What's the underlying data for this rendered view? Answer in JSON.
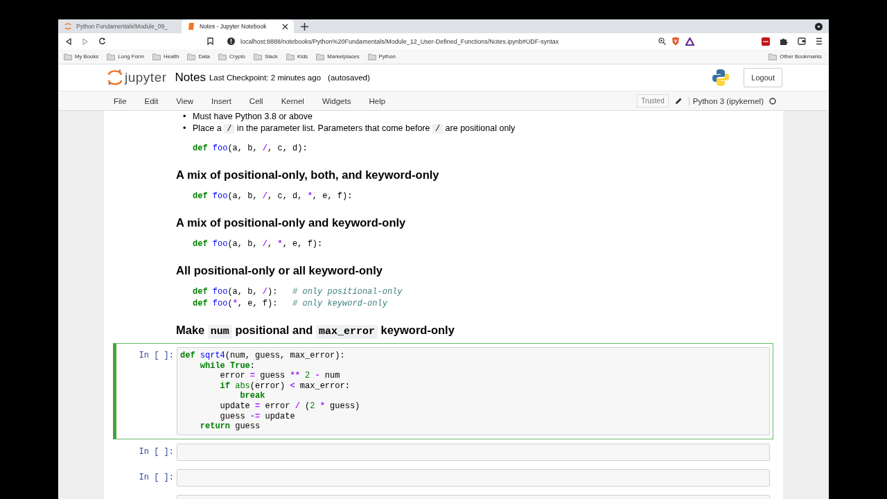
{
  "browser": {
    "tabs": [
      {
        "title": "Python Fundamentals/Module_09_",
        "selected": false
      },
      {
        "title": "Notes - Jupyter Notebook",
        "selected": true
      }
    ],
    "url": "localhost:8888/notebooks/Python%20Fundamentals/Module_12_User-Defined_Functions/Notes.ipynb#UDF-syntax",
    "bookmarks": [
      "My Books",
      "Long Form",
      "Health",
      "Data",
      "Crypto",
      "Slack",
      "Kids",
      "Marketplaces",
      "Python"
    ],
    "other_bookmarks": "Other Bookmarks"
  },
  "header": {
    "logo_text": "jupyter",
    "notebook_name": "Notes",
    "checkpoint": "Last Checkpoint: 2 minutes ago",
    "autosave": "(autosaved)",
    "logout": "Logout"
  },
  "menu": [
    "File",
    "Edit",
    "View",
    "Insert",
    "Cell",
    "Kernel",
    "Widgets",
    "Help"
  ],
  "toolbar": {
    "trusted": "Trusted",
    "kernel": "Python 3 (ipykernel)",
    "kernel_busy": false
  },
  "markdown": [
    {
      "kind": "bullets",
      "items": [
        {
          "marker": "•",
          "segments": [
            {
              "kind": "text",
              "text": "Must have Python 3.8 or above"
            }
          ]
        },
        {
          "marker": "•",
          "segments": [
            {
              "kind": "text",
              "text": "Place a "
            },
            {
              "kind": "code",
              "text": "/"
            },
            {
              "kind": "text",
              "text": " in the parameter list. Parameters that come before "
            },
            {
              "kind": "code",
              "text": "/"
            },
            {
              "kind": "text",
              "text": " are positional only"
            }
          ]
        }
      ]
    },
    {
      "kind": "code",
      "lines": [
        [
          {
            "kind": "kw",
            "text": "def"
          },
          {
            "kind": "fn",
            "text": " foo"
          },
          {
            "kind": "plain",
            "text": "(a, b, "
          },
          {
            "kind": "op",
            "text": "/"
          },
          {
            "kind": "plain",
            "text": ", c, d):"
          }
        ]
      ]
    },
    {
      "kind": "heading",
      "segments": [
        {
          "kind": "text",
          "text": "A mix of positional-only, both, and keyword-only"
        }
      ]
    },
    {
      "kind": "code",
      "lines": [
        [
          {
            "kind": "kw",
            "text": "def"
          },
          {
            "kind": "fn",
            "text": " foo"
          },
          {
            "kind": "plain",
            "text": "(a, b, "
          },
          {
            "kind": "op",
            "text": "/"
          },
          {
            "kind": "plain",
            "text": ", c, d, "
          },
          {
            "kind": "op",
            "text": "*"
          },
          {
            "kind": "plain",
            "text": ", e, f):"
          }
        ]
      ]
    },
    {
      "kind": "heading",
      "segments": [
        {
          "kind": "text",
          "text": "A mix of positional-only and keyword-only"
        }
      ]
    },
    {
      "kind": "code",
      "lines": [
        [
          {
            "kind": "kw",
            "text": "def"
          },
          {
            "kind": "fn",
            "text": " foo"
          },
          {
            "kind": "plain",
            "text": "(a, b, "
          },
          {
            "kind": "op",
            "text": "/"
          },
          {
            "kind": "plain",
            "text": ", "
          },
          {
            "kind": "op",
            "text": "*"
          },
          {
            "kind": "plain",
            "text": ", e, f):"
          }
        ]
      ]
    },
    {
      "kind": "heading",
      "segments": [
        {
          "kind": "text",
          "text": "All positional-only or all keyword-only"
        }
      ]
    },
    {
      "kind": "code",
      "lines": [
        [
          {
            "kind": "kw",
            "text": "def"
          },
          {
            "kind": "fn",
            "text": " foo"
          },
          {
            "kind": "plain",
            "text": "(a, b, "
          },
          {
            "kind": "op",
            "text": "/"
          },
          {
            "kind": "plain",
            "text": "):   "
          },
          {
            "kind": "comment",
            "text": "# only positional-only"
          }
        ],
        [
          {
            "kind": "kw",
            "text": "def"
          },
          {
            "kind": "fn",
            "text": " foo"
          },
          {
            "kind": "plain",
            "text": "("
          },
          {
            "kind": "op",
            "text": "*"
          },
          {
            "kind": "plain",
            "text": ", e, f):   "
          },
          {
            "kind": "comment",
            "text": "# only keyword-only"
          }
        ]
      ]
    },
    {
      "kind": "heading",
      "segments": [
        {
          "kind": "text",
          "text": "Make "
        },
        {
          "kind": "code",
          "text": "num"
        },
        {
          "kind": "text",
          "text": " positional and "
        },
        {
          "kind": "code",
          "text": "max_error"
        },
        {
          "kind": "text",
          "text": " keyword-only"
        }
      ]
    }
  ],
  "cells": [
    {
      "prompt": "In [ ]:",
      "selected": true,
      "lines": [
        [
          {
            "kind": "kw",
            "text": "def"
          },
          {
            "kind": "fn",
            "text": " sqrt4"
          },
          {
            "kind": "plain",
            "text": "(num, guess, max_error):"
          }
        ],
        [
          {
            "kind": "kw",
            "text": "    while True"
          },
          {
            "kind": "plain",
            "text": ":"
          }
        ],
        [
          {
            "kind": "plain",
            "text": "        error "
          },
          {
            "kind": "op",
            "text": "="
          },
          {
            "kind": "plain",
            "text": " guess "
          },
          {
            "kind": "op",
            "text": "**"
          },
          {
            "kind": "num",
            "text": " 2"
          },
          {
            "kind": "op",
            "text": " -"
          },
          {
            "kind": "plain",
            "text": " num"
          }
        ],
        [
          {
            "kind": "kw",
            "text": "        if"
          },
          {
            "kind": "builtin",
            "text": " abs"
          },
          {
            "kind": "plain",
            "text": "(error) "
          },
          {
            "kind": "op",
            "text": "<"
          },
          {
            "kind": "plain",
            "text": " max_error:"
          }
        ],
        [
          {
            "kind": "kw",
            "text": "            break"
          }
        ],
        [
          {
            "kind": "plain",
            "text": "        update "
          },
          {
            "kind": "op",
            "text": "="
          },
          {
            "kind": "plain",
            "text": " error "
          },
          {
            "kind": "op",
            "text": "/"
          },
          {
            "kind": "plain",
            "text": " ("
          },
          {
            "kind": "num",
            "text": "2"
          },
          {
            "kind": "op",
            "text": " *"
          },
          {
            "kind": "plain",
            "text": " guess)"
          }
        ],
        [
          {
            "kind": "plain",
            "text": "        guess "
          },
          {
            "kind": "op",
            "text": "-="
          },
          {
            "kind": "plain",
            "text": " update"
          }
        ],
        [
          {
            "kind": "kw",
            "text": "    return"
          },
          {
            "kind": "plain",
            "text": " guess"
          }
        ]
      ]
    },
    {
      "prompt": "In [ ]:",
      "selected": false
    },
    {
      "prompt": "In [ ]:",
      "selected": false
    },
    {
      "selected": false
    }
  ]
}
